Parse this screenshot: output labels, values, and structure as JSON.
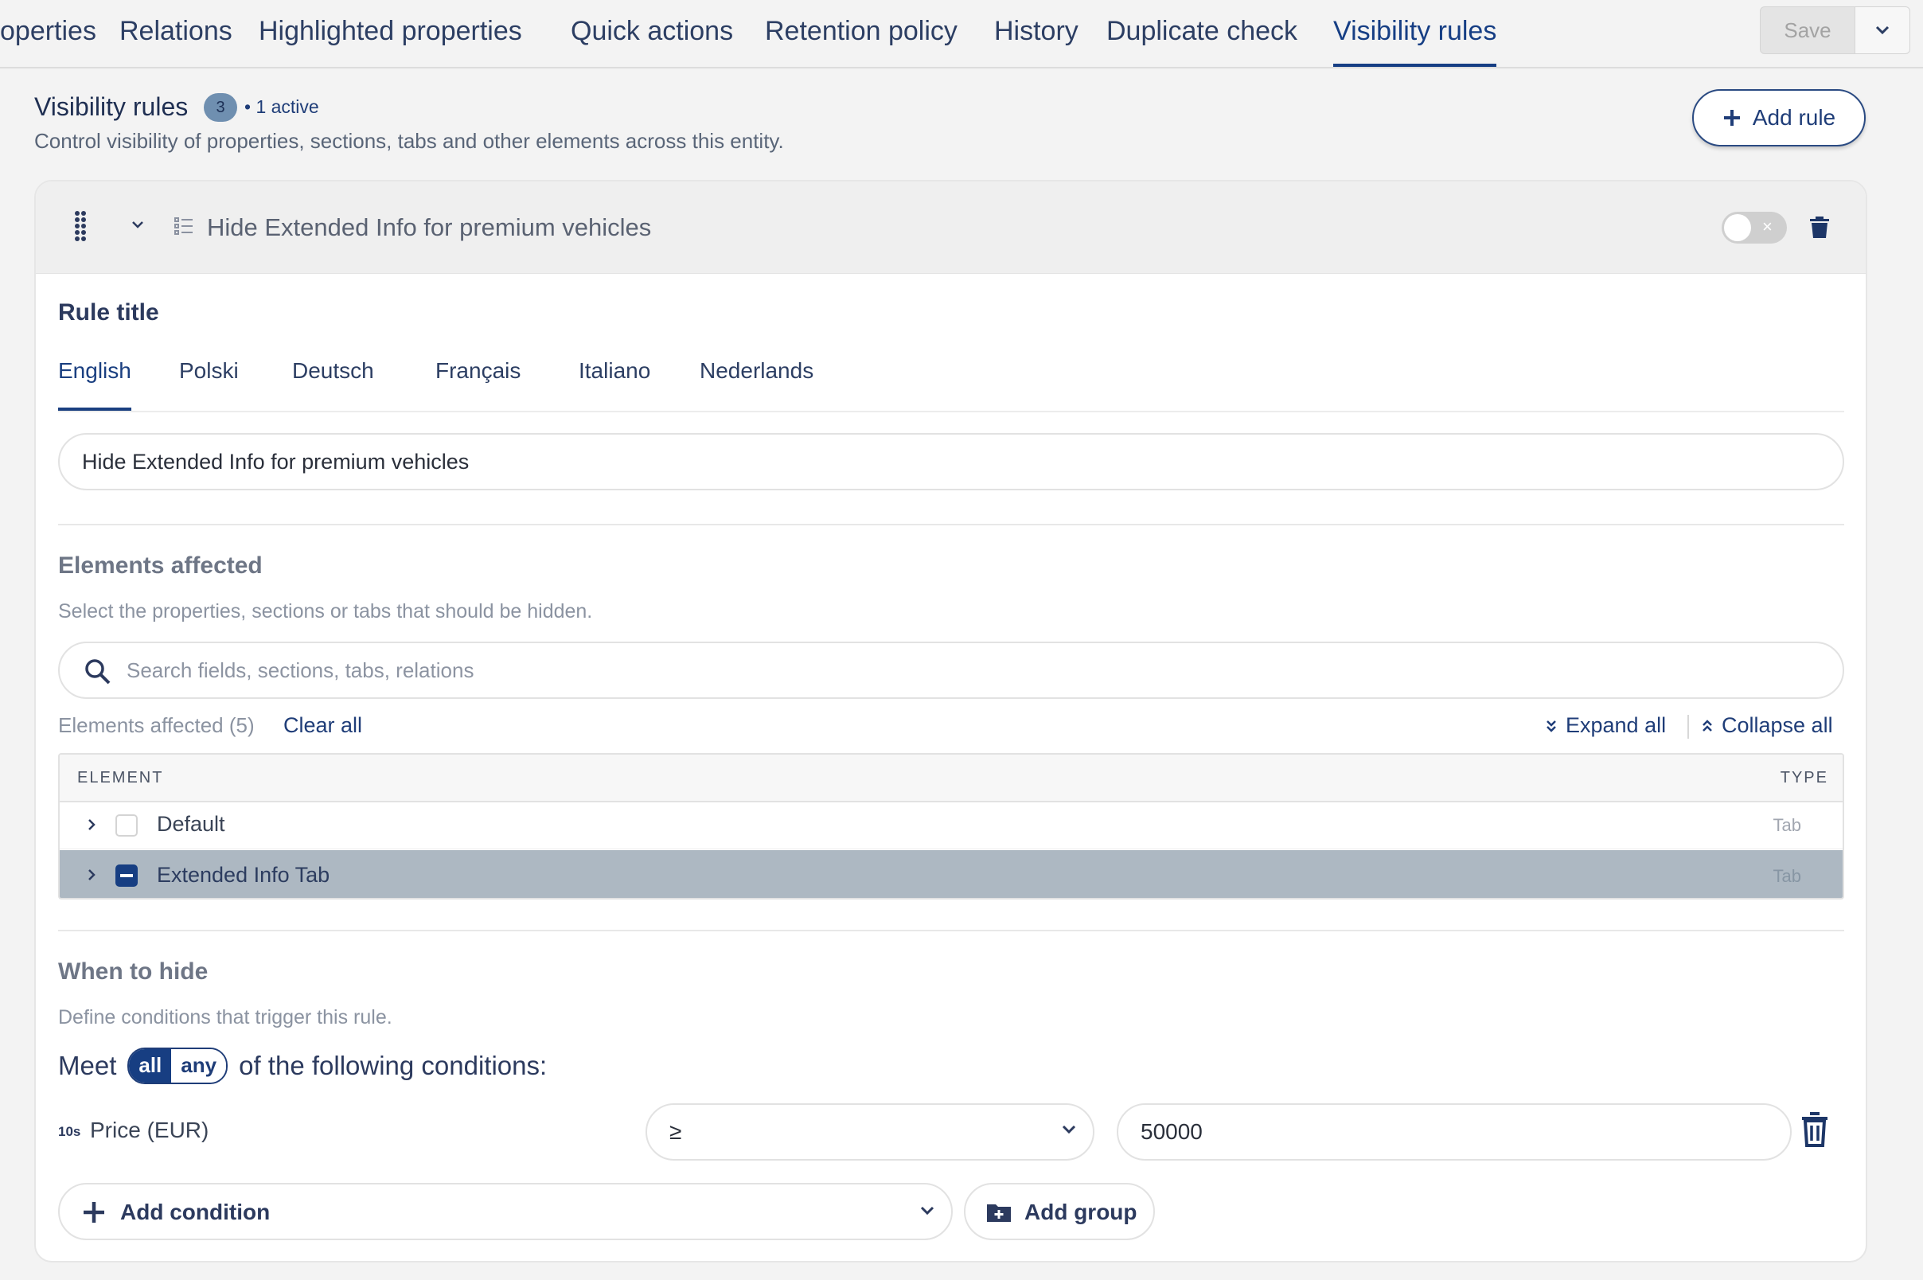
{
  "top_tabs": [
    {
      "label": "operties"
    },
    {
      "label": "Relations"
    },
    {
      "label": "Highlighted properties"
    },
    {
      "label": "Quick actions"
    },
    {
      "label": "Retention policy"
    },
    {
      "label": "History"
    },
    {
      "label": "Duplicate check"
    },
    {
      "label": "Visibility rules",
      "active": true
    }
  ],
  "save_label": "Save",
  "header": {
    "title": "Visibility rules",
    "count": "3",
    "active_text": "• 1 active",
    "description": "Control visibility of properties, sections, tabs and other elements across this entity.",
    "add_rule_label": "Add rule"
  },
  "rule": {
    "title": "Hide Extended Info for premium vehicles",
    "enabled": false,
    "rule_title_label": "Rule title",
    "languages": [
      "English",
      "Polski",
      "Deutsch",
      "Français",
      "Italiano",
      "Nederlands"
    ],
    "active_language": "English",
    "title_value": "Hide Extended Info for premium vehicles",
    "elements": {
      "heading": "Elements affected",
      "help": "Select the properties, sections or tabs that should be hidden.",
      "search_placeholder": "Search fields, sections, tabs, relations",
      "count_label": "Elements affected (5)",
      "clear_all": "Clear all",
      "expand_all": "Expand all",
      "collapse_all": "Collapse all",
      "col_element": "ELEMENT",
      "col_type": "TYPE",
      "rows": [
        {
          "name": "Default",
          "type": "Tab",
          "checked": "none"
        },
        {
          "name": "Extended Info Tab",
          "type": "Tab",
          "checked": "partial"
        }
      ]
    },
    "when": {
      "heading": "When to hide",
      "help": "Define conditions that trigger this rule.",
      "meet_prefix": "Meet",
      "mode_all": "all",
      "mode_any": "any",
      "selected_mode": "all",
      "meet_suffix": "of the following conditions:",
      "conditions": [
        {
          "type_badge": "10s",
          "field": "Price (EUR)",
          "operator": "≥",
          "value": "50000"
        }
      ],
      "add_condition": "Add condition",
      "add_group": "Add group"
    }
  },
  "colors": {
    "accent": "#163e84",
    "selected_row": "#adb8c2",
    "badge": "#6f8fb0"
  }
}
